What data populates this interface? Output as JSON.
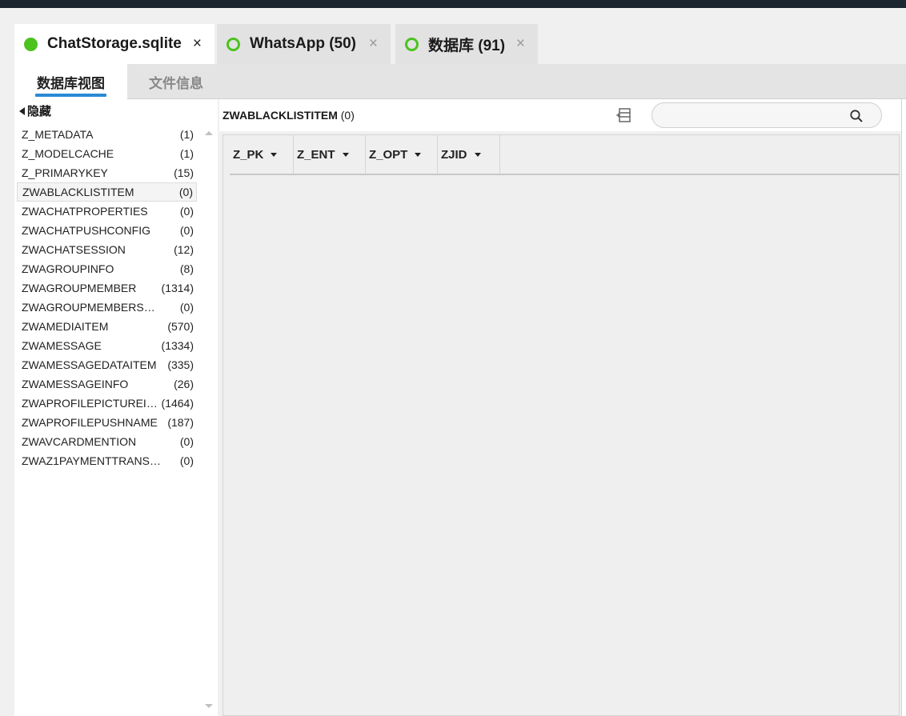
{
  "file_tabs": [
    {
      "label": "ChatStorage.sqlite",
      "close": "×"
    },
    {
      "label": "WhatsApp (50)",
      "close": "×"
    },
    {
      "label": "数据库 (91)",
      "close": "×"
    }
  ],
  "sub_tabs": [
    {
      "label": "数据库视图"
    },
    {
      "label": "文件信息"
    }
  ],
  "sidebar": {
    "hide_label": "隐藏",
    "tables": [
      {
        "name": "Z_METADATA",
        "count": "(1)"
      },
      {
        "name": "Z_MODELCACHE",
        "count": "(1)"
      },
      {
        "name": "Z_PRIMARYKEY",
        "count": "(15)"
      },
      {
        "name": "ZWABLACKLISTITEM",
        "count": "(0)"
      },
      {
        "name": "ZWACHATPROPERTIES",
        "count": "(0)"
      },
      {
        "name": "ZWACHATPUSHCONFIG",
        "count": "(0)"
      },
      {
        "name": "ZWACHATSESSION",
        "count": "(12)"
      },
      {
        "name": "ZWAGROUPINFO",
        "count": "(8)"
      },
      {
        "name": "ZWAGROUPMEMBER",
        "count": "(1314)"
      },
      {
        "name": "ZWAGROUPMEMBERSCHA...",
        "count": "(0)"
      },
      {
        "name": "ZWAMEDIAITEM",
        "count": "(570)"
      },
      {
        "name": "ZWAMESSAGE",
        "count": "(1334)"
      },
      {
        "name": "ZWAMESSAGEDATAITEM",
        "count": "(335)"
      },
      {
        "name": "ZWAMESSAGEINFO",
        "count": "(26)"
      },
      {
        "name": "ZWAPROFILEPICTUREITE...",
        "count": "(1464)"
      },
      {
        "name": "ZWAPROFILEPUSHNAME",
        "count": "(187)"
      },
      {
        "name": "ZWAVCARDMENTION",
        "count": "(0)"
      },
      {
        "name": "ZWAZ1PAYMENTTRANSACT...",
        "count": "(0)"
      }
    ]
  },
  "main": {
    "table_name": "ZWABLACKLISTITEM",
    "table_count": "(0)",
    "search": {
      "placeholder": ""
    },
    "columns": [
      "Z_PK",
      "Z_ENT",
      "Z_OPT",
      "ZJID"
    ]
  },
  "colors": {
    "status_green": "#4cc21f",
    "accent_blue": "#2a8ad4",
    "titlebar": "#1b2631"
  },
  "icons": {
    "tab_status": "status-dot-icon",
    "column_chooser": "column-chooser-icon",
    "search": "search-icon"
  }
}
